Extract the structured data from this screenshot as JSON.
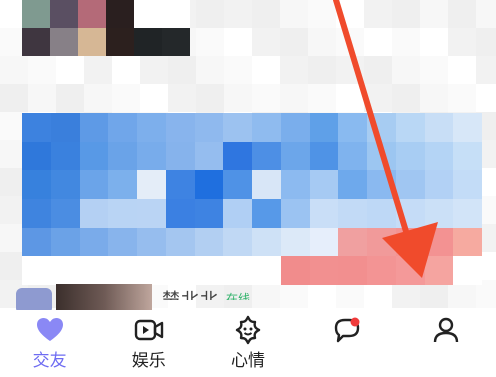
{
  "tabs": [
    {
      "label": "交友",
      "icon": "heart-icon",
      "active": true
    },
    {
      "label": "娱乐",
      "icon": "video-icon",
      "active": false
    },
    {
      "label": "心情",
      "icon": "mood-star-icon",
      "active": false
    },
    {
      "label": "",
      "icon": "message-icon",
      "active": false
    },
    {
      "label": "",
      "icon": "profile-icon",
      "active": false
    }
  ],
  "list_item": {
    "name": "楚北北",
    "status": "在线"
  },
  "colors": {
    "accent": "#6e6cf2",
    "arrow": "#f04b2c",
    "banner_blue": "#3a84e0",
    "banner_pink": "#f09090"
  }
}
